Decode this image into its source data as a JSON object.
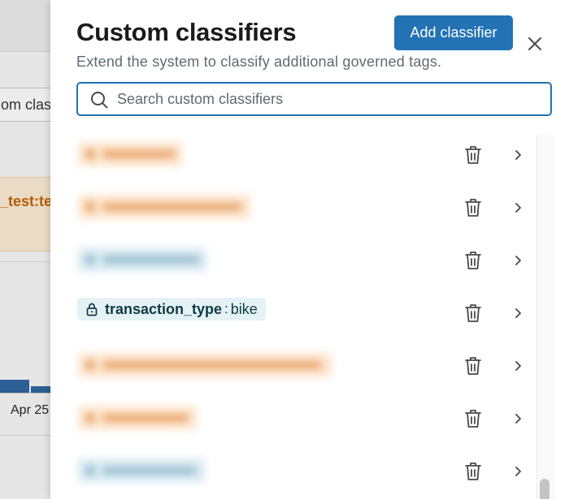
{
  "background": {
    "input_partial_text": "om class",
    "tag_partial_text": "_test:te",
    "axis_label": "Apr 25"
  },
  "drawer": {
    "title": "Custom classifiers",
    "subtitle": "Extend the system to classify additional governed tags.",
    "add_button_label": "Add classifier",
    "close_icon": "close-icon",
    "search": {
      "placeholder": "Search custom classifiers",
      "value": ""
    },
    "classifiers": [
      {
        "label": "start_date",
        "blurred": true,
        "color": "orange"
      },
      {
        "label": "supplier_ingredients",
        "blurred": true,
        "color": "orange"
      },
      {
        "label": "text_pan_title",
        "blurred": true,
        "color": "blue"
      },
      {
        "key": "transaction_type",
        "separator": ":",
        "value": "bike",
        "blurred": false,
        "locked": true,
        "icon": "lock-icon"
      },
      {
        "label": "visit-new-custom special value",
        "blurred": true,
        "color": "orange"
      },
      {
        "label": "visit_custom",
        "blurred": true,
        "color": "orange"
      },
      {
        "label": "workspace_id",
        "blurred": true,
        "color": "blue"
      }
    ],
    "row_actions": {
      "delete_icon": "trash-icon",
      "open_icon": "chevron-right-icon"
    }
  },
  "colors": {
    "accent": "#2272b4",
    "blurred_orange": "#fde6cf",
    "blurred_blue": "#dbecf3",
    "locked_tag_bg": "#e4f2f5"
  }
}
